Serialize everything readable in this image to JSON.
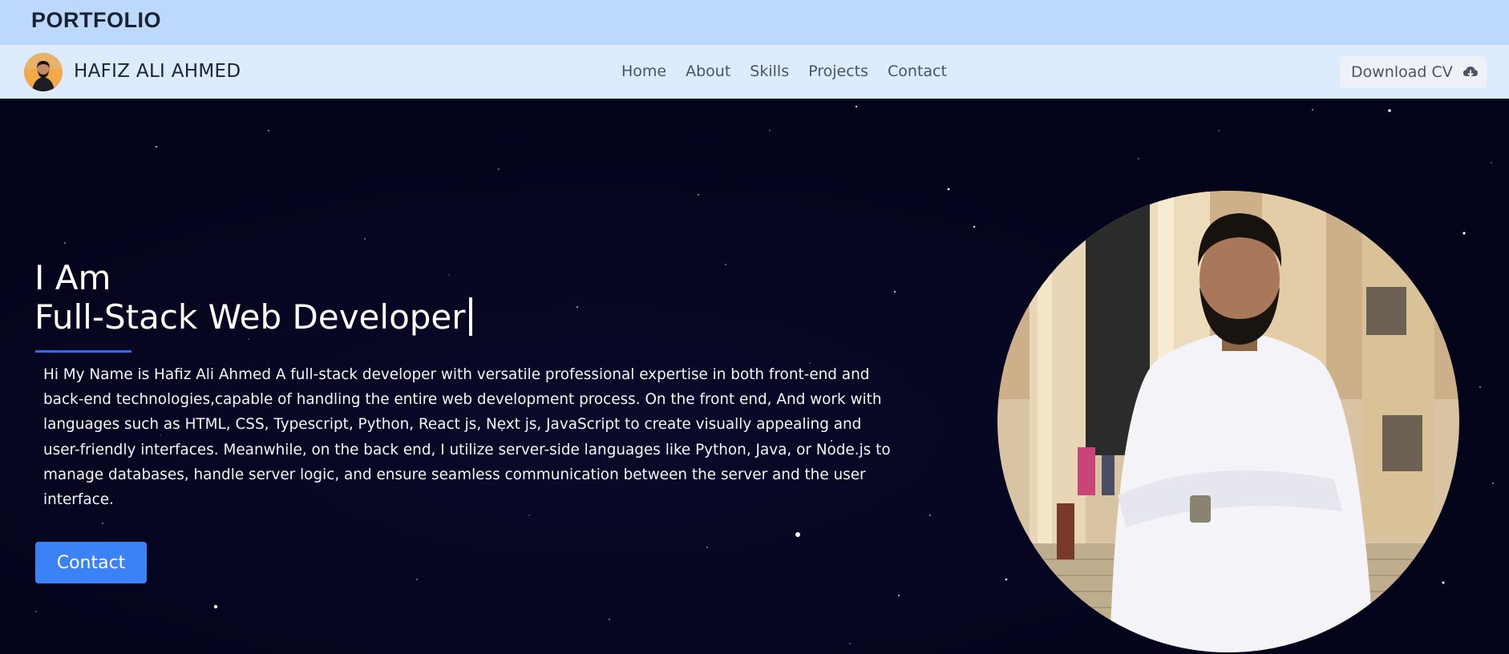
{
  "topbar": {
    "brand": "PORTFOLIO"
  },
  "navbar": {
    "owner_name": "HAFIZ ALI AHMED",
    "links": [
      "Home",
      "About",
      "Skills",
      "Projects",
      "Contact"
    ],
    "download_label": "Download CV",
    "download_icon": "cloud-download-icon"
  },
  "hero": {
    "intro": "I Am",
    "role": "Full-Stack Web Developer",
    "bio": "Hi My Name is Hafiz Ali Ahmed A full-stack developer with versatile professional expertise in both front-end and back-end technologies,capable of handling the entire web development process. On the front end, And work with languages such as HTML, CSS, Typescript, Python, React js, Next js, JavaScript to create visually appealing and user-friendly interfaces. Meanwhile, on the back end, I utilize server-side languages like Python, Java, or Node.js to manage databases, handle server logic, and ensure seamless communication between the server and the user interface.",
    "contact_label": "Contact"
  },
  "colors": {
    "topbar_bg": "#bcd9fd",
    "navbar_bg": "#dcebfe",
    "hero_bg": "#03031a",
    "accent": "#3b82f6",
    "underline": "#2f6af2"
  }
}
